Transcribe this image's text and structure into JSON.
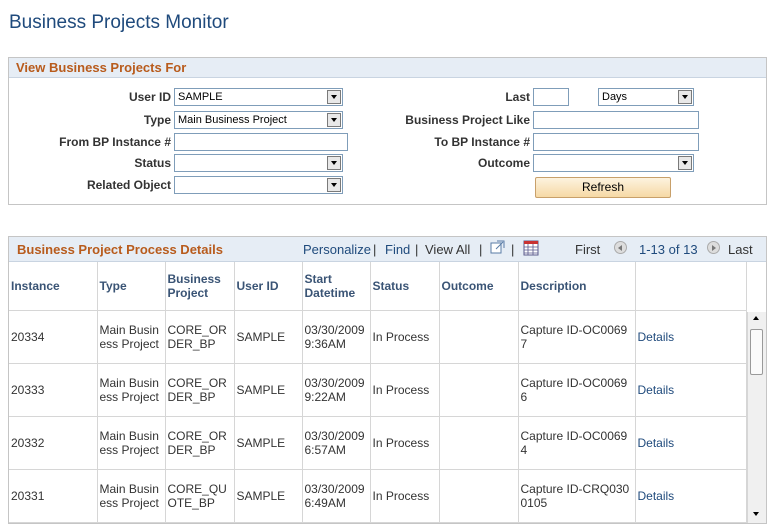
{
  "page": {
    "title": "Business Projects Monitor"
  },
  "filters": {
    "header": "View Business Projects For",
    "user_id_label": "User ID",
    "user_id_value": "SAMPLE",
    "type_label": "Type",
    "type_value": "Main Business Project",
    "from_bp_label": "From BP Instance #",
    "from_bp_value": "",
    "status_label": "Status",
    "status_value": "",
    "related_object_label": "Related Object",
    "related_object_value": "",
    "last_label": "Last",
    "last_value": "",
    "last_unit_value": "Days",
    "bp_like_label": "Business Project Like",
    "bp_like_value": "",
    "to_bp_label": "To BP Instance #",
    "to_bp_value": "",
    "outcome_label": "Outcome",
    "outcome_value": "",
    "refresh_label": "Refresh"
  },
  "grid": {
    "title": "Business Project Process Details",
    "personalize": "Personalize",
    "find": "Find",
    "view_all": "View All",
    "separator": "|",
    "first": "First",
    "range": "1-13 of 13",
    "last": "Last",
    "columns": [
      "Instance",
      "Type",
      "Business Project",
      "User ID",
      "Start Datetime",
      "Status",
      "Outcome",
      "Description",
      ""
    ],
    "rows": [
      {
        "instance": "20334",
        "type": "Main Business Project",
        "project": "CORE_ORDER_BP",
        "user": "SAMPLE",
        "start": "03/30/2009 9:36AM",
        "status": "In Process",
        "outcome": "",
        "description": "Capture ID-OC00697",
        "link": "Details"
      },
      {
        "instance": "20333",
        "type": "Main Business Project",
        "project": "CORE_ORDER_BP",
        "user": "SAMPLE",
        "start": "03/30/2009 9:22AM",
        "status": "In Process",
        "outcome": "",
        "description": "Capture ID-OC00696",
        "link": "Details"
      },
      {
        "instance": "20332",
        "type": "Main Business Project",
        "project": "CORE_ORDER_BP",
        "user": "SAMPLE",
        "start": "03/30/2009 6:57AM",
        "status": "In Process",
        "outcome": "",
        "description": "Capture ID-OC00694",
        "link": "Details"
      },
      {
        "instance": "20331",
        "type": "Main Business Project",
        "project": "CORE_QUOTE_BP",
        "user": "SAMPLE",
        "start": "03/30/2009 6:49AM",
        "status": "In Process",
        "outcome": "",
        "description": "Capture ID-CRQ0300105",
        "link": "Details"
      }
    ]
  }
}
